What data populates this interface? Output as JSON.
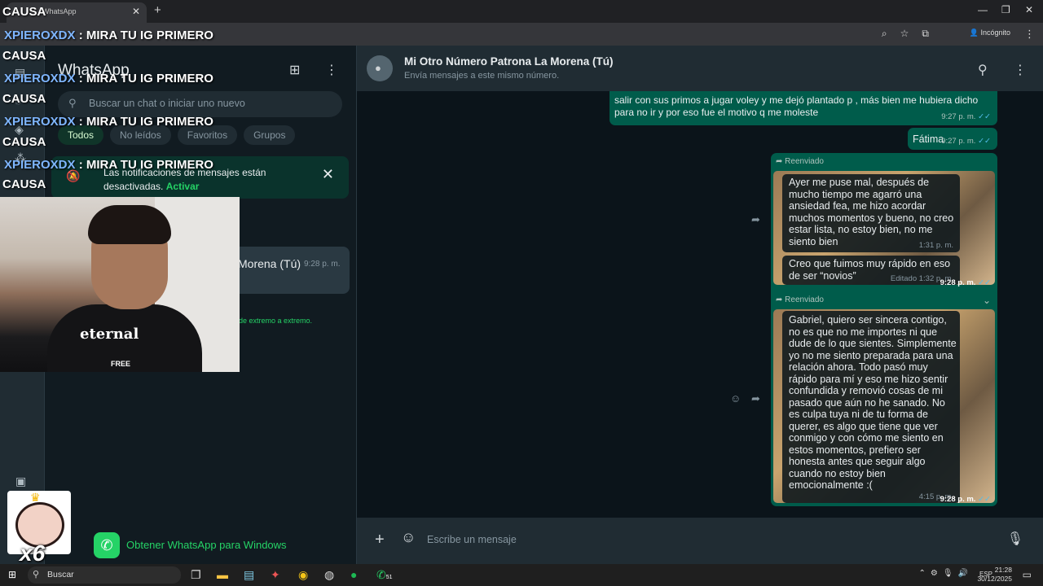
{
  "browser": {
    "tab_title": "WhatsApp",
    "incognito_label": "Incógnito",
    "new_tab_icon": "+",
    "tab_close_icon": "✕"
  },
  "sidebar": {
    "title": "WhatsApp",
    "search_placeholder": "Buscar un chat o iniciar uno nuevo",
    "filters": [
      "Todos",
      "No leídos",
      "Favoritos",
      "Grupos"
    ],
    "active_filter": "Todos",
    "notification": {
      "text": "Las notificaciones de mensajes están desactivadas.",
      "action": "Activar"
    },
    "chat_item": {
      "name": "Morena (Tú)",
      "time": "9:28 p. m."
    },
    "e2e_text": "de extremo a extremo.",
    "get_app": "Obtener WhatsApp para Windows"
  },
  "chat": {
    "name": "Mi Otro Número Patrona La Morena (Tú)",
    "subtitle": "Envía mensajes a este mismo número.",
    "messages": [
      {
        "text": "salir con sus primos a jugar voley y me dejó plantado p , más bien me hubiera dicho para no ir y por eso fue el motivo q me moleste",
        "time": "9:27 p. m."
      },
      {
        "text": "Fátima",
        "time": "9:27 p. m."
      }
    ],
    "forward1": {
      "label": "Reenviado",
      "quote1": "Ayer me puse mal, después de mucho tiempo me agarró una ansiedad fea, me hizo acordar muchos momentos y bueno, no creo estar lista, no estoy bien, no me siento bien",
      "quote1_time": "1:31 p. m.",
      "quote2": "Creo que fuimos muy rápido en eso de ser “novios”",
      "quote2_meta": "Editado 1:32 p. m.",
      "time": "9:28 p. m."
    },
    "forward2": {
      "label": "Reenviado",
      "quote": "Gabriel, quiero ser sincera contigo, no es que no me importes ni que dude de lo que sientes. Simplemente yo no me siento preparada para una relación ahora. Todo pasó muy rápido para mí y eso me hizo sentir confundida y removió cosas de mi pasado que aún no he sanado. No es culpa tuya ni de tu forma de querer, es algo que tiene que ver conmigo y con cómo me siento en estos momentos, prefiero ser honesta antes que seguir algo cuando no estoy bien emocionalmente :(",
      "quote_time": "4:15 p. m.",
      "time": "9:28 p. m."
    },
    "composer_placeholder": "Escribe un mensaje"
  },
  "overlay": {
    "causa_label": "CAUSA",
    "chat_user": "XPIEROXDX",
    "chat_text": ": MIRA TU IG PRIMERO",
    "webcam_shirt": "eternal",
    "webcam_shirt_sub": "FREE",
    "multiplier": "x6"
  },
  "taskbar": {
    "search_label": "Buscar",
    "lang": "ESP",
    "time": "21:28",
    "date": "30/12/2025",
    "whatsapp_badge": "51"
  },
  "colors": {
    "outgoing_bubble": "#005c4b",
    "accent": "#25d366",
    "panel": "#202c33",
    "background": "#0b141a",
    "read_tick": "#53bdeb"
  }
}
